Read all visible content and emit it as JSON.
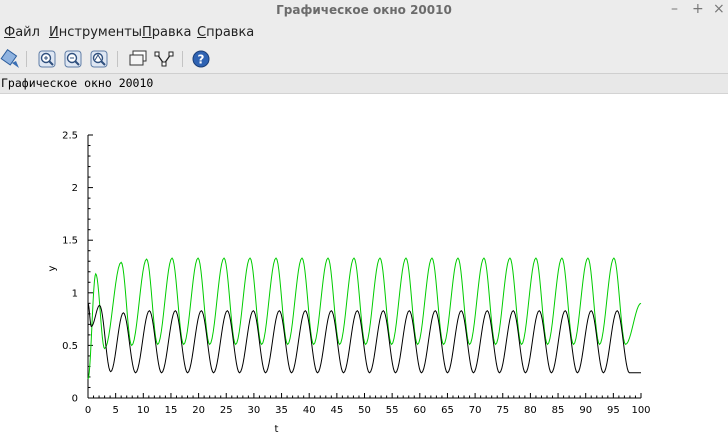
{
  "window": {
    "title": "Графическое окно 20010"
  },
  "menubar": {
    "items": [
      {
        "first": "Ф",
        "rest": "айл"
      },
      {
        "first": "И",
        "rest": "нструменты"
      },
      {
        "first": "П",
        "rest": "равка"
      },
      {
        "first": "С",
        "rest": "правка"
      }
    ]
  },
  "toolbar": {
    "icons": [
      "rotate-icon",
      "zoom-in-icon",
      "zoom-out-icon",
      "zoom-reset-icon",
      "datatip-icon",
      "edit-curve-icon",
      "help-icon"
    ]
  },
  "figure": {
    "label": "Графическое окно 20010"
  },
  "chart_data": {
    "type": "line",
    "title": "",
    "xlabel": "t",
    "ylabel": "y",
    "xlim": [
      0,
      100
    ],
    "ylim": [
      0,
      2.5
    ],
    "xticks": [
      0,
      5,
      10,
      15,
      20,
      25,
      30,
      35,
      40,
      45,
      50,
      55,
      60,
      65,
      70,
      75,
      80,
      85,
      90,
      95,
      100
    ],
    "xticklabels": [
      "0",
      "5",
      "10",
      "15",
      "20",
      "25",
      "30",
      "35",
      "40",
      "45",
      "50",
      "55",
      "60",
      "65",
      "70",
      "75",
      "80",
      "85",
      "90",
      "95",
      "100"
    ],
    "yticks": [
      0,
      0.5,
      1,
      1.5,
      2,
      2.5
    ],
    "yticklabels": [
      "0",
      "0.5",
      "1",
      "1.5",
      "2",
      "2.5"
    ],
    "grid": false,
    "series": [
      {
        "color": "#00cc00",
        "points": [
          [
            0,
            0.18
          ],
          [
            1.4,
            1.18
          ],
          [
            3.0,
            0.47
          ],
          [
            6.0,
            1.29
          ],
          [
            7.9,
            0.5
          ],
          [
            10.6,
            1.32
          ],
          [
            12.6,
            0.51
          ],
          [
            15.2,
            1.33
          ],
          [
            17.3,
            0.51
          ],
          [
            19.9,
            1.33
          ],
          [
            22.0,
            0.51
          ],
          [
            24.6,
            1.33
          ],
          [
            26.7,
            0.51
          ],
          [
            29.3,
            1.33
          ],
          [
            31.4,
            0.51
          ],
          [
            34.0,
            1.33
          ],
          [
            36.1,
            0.51
          ],
          [
            38.7,
            1.33
          ],
          [
            40.8,
            0.51
          ],
          [
            43.4,
            1.33
          ],
          [
            45.5,
            0.51
          ],
          [
            48.1,
            1.33
          ],
          [
            50.2,
            0.51
          ],
          [
            52.8,
            1.33
          ],
          [
            54.9,
            0.51
          ],
          [
            57.5,
            1.33
          ],
          [
            59.6,
            0.51
          ],
          [
            62.2,
            1.33
          ],
          [
            64.3,
            0.51
          ],
          [
            66.9,
            1.33
          ],
          [
            69.0,
            0.51
          ],
          [
            71.6,
            1.33
          ],
          [
            73.7,
            0.51
          ],
          [
            76.3,
            1.33
          ],
          [
            78.4,
            0.51
          ],
          [
            81.0,
            1.33
          ],
          [
            83.1,
            0.51
          ],
          [
            85.7,
            1.33
          ],
          [
            87.8,
            0.51
          ],
          [
            90.4,
            1.33
          ],
          [
            92.5,
            0.51
          ],
          [
            95.1,
            1.33
          ],
          [
            97.2,
            0.51
          ],
          [
            100,
            0.9
          ]
        ]
      },
      {
        "color": "#000000",
        "points": [
          [
            0,
            0.9
          ],
          [
            0.6,
            0.68
          ],
          [
            2.1,
            0.88
          ],
          [
            4.1,
            0.25
          ],
          [
            6.4,
            0.81
          ],
          [
            8.6,
            0.24
          ],
          [
            11.1,
            0.83
          ],
          [
            13.3,
            0.24
          ],
          [
            15.8,
            0.83
          ],
          [
            18.0,
            0.24
          ],
          [
            20.5,
            0.83
          ],
          [
            22.7,
            0.24
          ],
          [
            25.2,
            0.83
          ],
          [
            27.4,
            0.24
          ],
          [
            29.9,
            0.83
          ],
          [
            32.1,
            0.24
          ],
          [
            34.6,
            0.83
          ],
          [
            36.8,
            0.24
          ],
          [
            39.3,
            0.83
          ],
          [
            41.5,
            0.24
          ],
          [
            44.0,
            0.83
          ],
          [
            46.2,
            0.24
          ],
          [
            48.7,
            0.83
          ],
          [
            50.9,
            0.24
          ],
          [
            53.4,
            0.83
          ],
          [
            55.6,
            0.24
          ],
          [
            58.1,
            0.83
          ],
          [
            60.3,
            0.24
          ],
          [
            62.8,
            0.83
          ],
          [
            65.0,
            0.24
          ],
          [
            67.5,
            0.83
          ],
          [
            69.7,
            0.24
          ],
          [
            72.2,
            0.83
          ],
          [
            74.4,
            0.24
          ],
          [
            76.9,
            0.83
          ],
          [
            79.1,
            0.24
          ],
          [
            81.6,
            0.83
          ],
          [
            83.8,
            0.24
          ],
          [
            86.3,
            0.83
          ],
          [
            88.5,
            0.24
          ],
          [
            91.0,
            0.83
          ],
          [
            93.2,
            0.24
          ],
          [
            95.7,
            0.83
          ],
          [
            97.9,
            0.24
          ],
          [
            100,
            0.24
          ]
        ]
      }
    ]
  }
}
